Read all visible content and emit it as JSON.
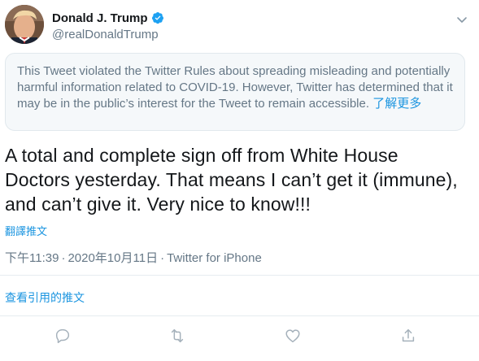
{
  "author": {
    "display_name": "Donald J. Trump",
    "handle": "@realDonaldTrump",
    "verified": true
  },
  "notice": {
    "text": "This Tweet violated the Twitter Rules about spreading misleading and potentially harmful information related to COVID-19. However, Twitter has determined that it may be in the public’s interest for the Tweet to remain accessible.",
    "link_label": "了解更多"
  },
  "tweet": {
    "text": "A total and complete sign off from White House Doctors yesterday. That means I can’t get it (immune), and can’t give it. Very nice to know!!!",
    "translate_label": "翻譯推文",
    "time": "下午11:39",
    "date": "2020年10月11日",
    "source": "Twitter for iPhone",
    "separator": "·"
  },
  "quotes": {
    "label": "查看引用的推文"
  },
  "actions": {
    "items": [
      {
        "name": "reply",
        "icon": "reply-icon"
      },
      {
        "name": "retweet",
        "icon": "retweet-icon"
      },
      {
        "name": "like",
        "icon": "like-icon"
      },
      {
        "name": "share",
        "icon": "share-icon"
      }
    ]
  },
  "colors": {
    "link": "#1b95e0",
    "secondary_text": "#657786",
    "notice_background": "#f5f8fa",
    "verified": "#1da1f2",
    "action_icon": "#a5b1bb"
  }
}
